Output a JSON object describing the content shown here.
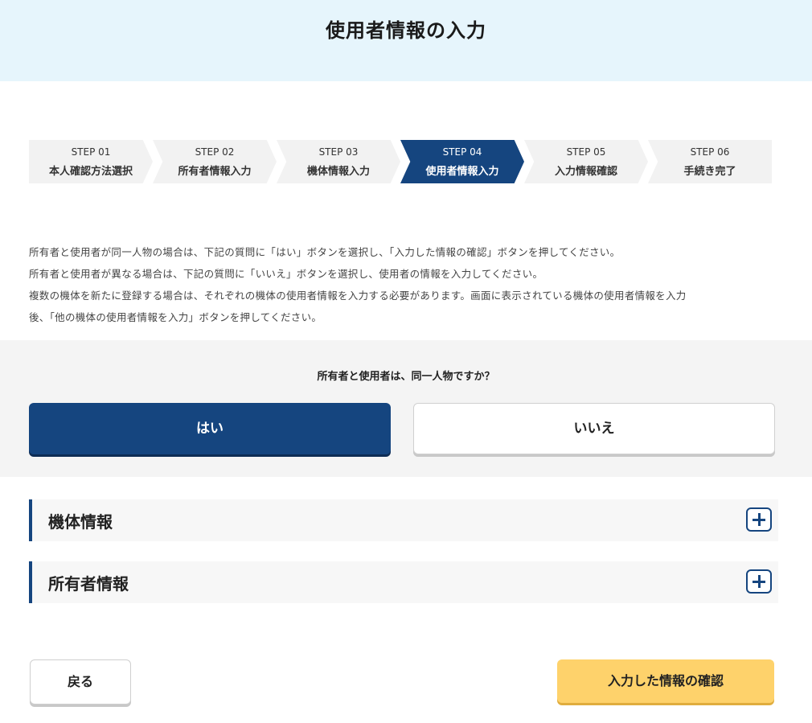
{
  "header": {
    "title": "使用者情報の入力"
  },
  "steps": [
    {
      "num": "STEP 01",
      "label": "本人確認方法選択"
    },
    {
      "num": "STEP 02",
      "label": "所有者情報入力"
    },
    {
      "num": "STEP 03",
      "label": "機体情報入力"
    },
    {
      "num": "STEP 04",
      "label": "使用者情報入力",
      "active": true
    },
    {
      "num": "STEP 05",
      "label": "入力情報確認"
    },
    {
      "num": "STEP 06",
      "label": "手続き完了"
    }
  ],
  "intro": [
    "所有者と使用者が同一人物の場合は、下記の質問に「はい」ボタンを選択し、「入力した情報の確認」ボタンを押してください。",
    "所有者と使用者が異なる場合は、下記の質問に「いいえ」ボタンを選択し、使用者の情報を入力してください。",
    "複数の機体を新たに登録する場合は、それぞれの機体の使用者情報を入力する必要があります。画面に表示されている機体の使用者情報を入力",
    "後、「他の機体の使用者情報を入力」ボタンを押してください。"
  ],
  "question": {
    "text": "所有者と使用者は、同一人物ですか？",
    "yes_label": "はい",
    "no_label": "いいえ",
    "selected": "yes"
  },
  "accordions": [
    {
      "title": "機体情報",
      "icon": "plus-icon"
    },
    {
      "title": "所有者情報",
      "icon": "plus-icon"
    }
  ],
  "footer": {
    "back_label": "戻る",
    "confirm_label": "入力した情報の確認"
  },
  "colors": {
    "primary": "#15457f",
    "header_bg": "#e6f5fc",
    "confirm_bg": "#fed26b"
  }
}
